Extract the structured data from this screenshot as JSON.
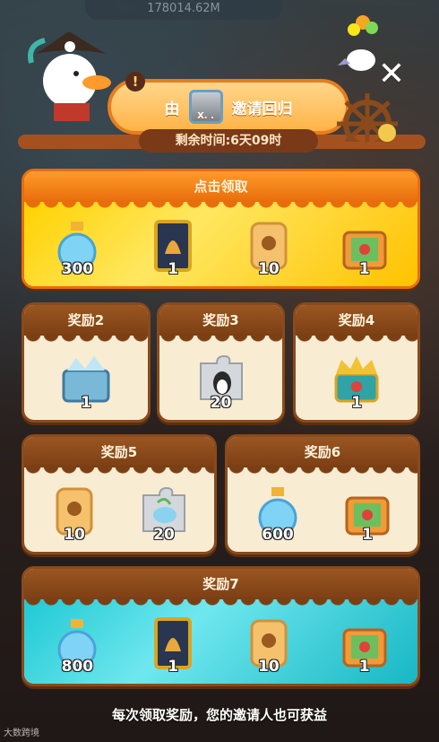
{
  "top_counter": "178014.62M",
  "header": {
    "from_label": "由",
    "inviter_name": "X. .",
    "invite_text": "邀请回归",
    "timer": "剩余时间:6天09时"
  },
  "main_card": {
    "title": "点击领取",
    "items": [
      {
        "icon": "blue-potion-icon",
        "count": "300"
      },
      {
        "icon": "golden-card-icon",
        "count": "1"
      },
      {
        "icon": "skull-biscuit-icon",
        "count": "10"
      },
      {
        "icon": "treasure-chest-icon",
        "count": "1"
      }
    ]
  },
  "rewards": [
    {
      "title": "奖励2",
      "items": [
        {
          "icon": "ice-chest-icon",
          "count": "1"
        }
      ]
    },
    {
      "title": "奖励3",
      "items": [
        {
          "icon": "penguin-puzzle-icon",
          "count": "20"
        }
      ]
    },
    {
      "title": "奖励4",
      "items": [
        {
          "icon": "crown-chest-icon",
          "count": "1"
        }
      ]
    },
    {
      "title": "奖励5",
      "items": [
        {
          "icon": "skull-biscuit-icon",
          "count": "10"
        },
        {
          "icon": "bird-puzzle-icon",
          "count": "20"
        }
      ]
    },
    {
      "title": "奖励6",
      "items": [
        {
          "icon": "blue-potion-icon",
          "count": "600"
        },
        {
          "icon": "treasure-chest-icon",
          "count": "1"
        }
      ]
    }
  ],
  "final_card": {
    "title": "奖励7",
    "items": [
      {
        "icon": "blue-potion-icon",
        "count": "800"
      },
      {
        "icon": "golden-card-icon",
        "count": "1"
      },
      {
        "icon": "skull-biscuit-icon",
        "count": "10"
      },
      {
        "icon": "treasure-chest-icon",
        "count": "1"
      }
    ]
  },
  "footer": "每次领取奖励，您的邀请人也可获益",
  "watermark": "大数跨境"
}
